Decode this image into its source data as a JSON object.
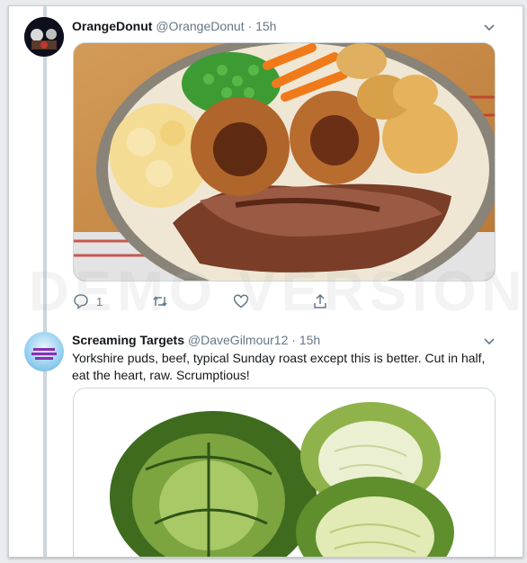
{
  "tweets": [
    {
      "display_name": "OrangeDonut",
      "handle": "@OrangeDonut",
      "separator": "·",
      "time": "15h",
      "text": "",
      "actions": {
        "reply_count": "1",
        "retweet_count": "",
        "like_count": ""
      }
    },
    {
      "display_name": "Screaming Targets",
      "handle": "@DaveGilmour12",
      "separator": "·",
      "time": "15h",
      "text": "Yorkshire puds, beef, typical Sunday roast except this is better. Cut in half, eat the heart, raw. Scrumptious!"
    }
  ],
  "watermark": "DEMO VERSION",
  "icons": {
    "reply": "reply-icon",
    "retweet": "retweet-icon",
    "like": "heart-icon",
    "share": "share-icon",
    "more": "chevron-down-icon"
  },
  "colors": {
    "secondary_text": "#657786",
    "primary_text": "#14171a",
    "thread_line": "#ccd6dd"
  }
}
